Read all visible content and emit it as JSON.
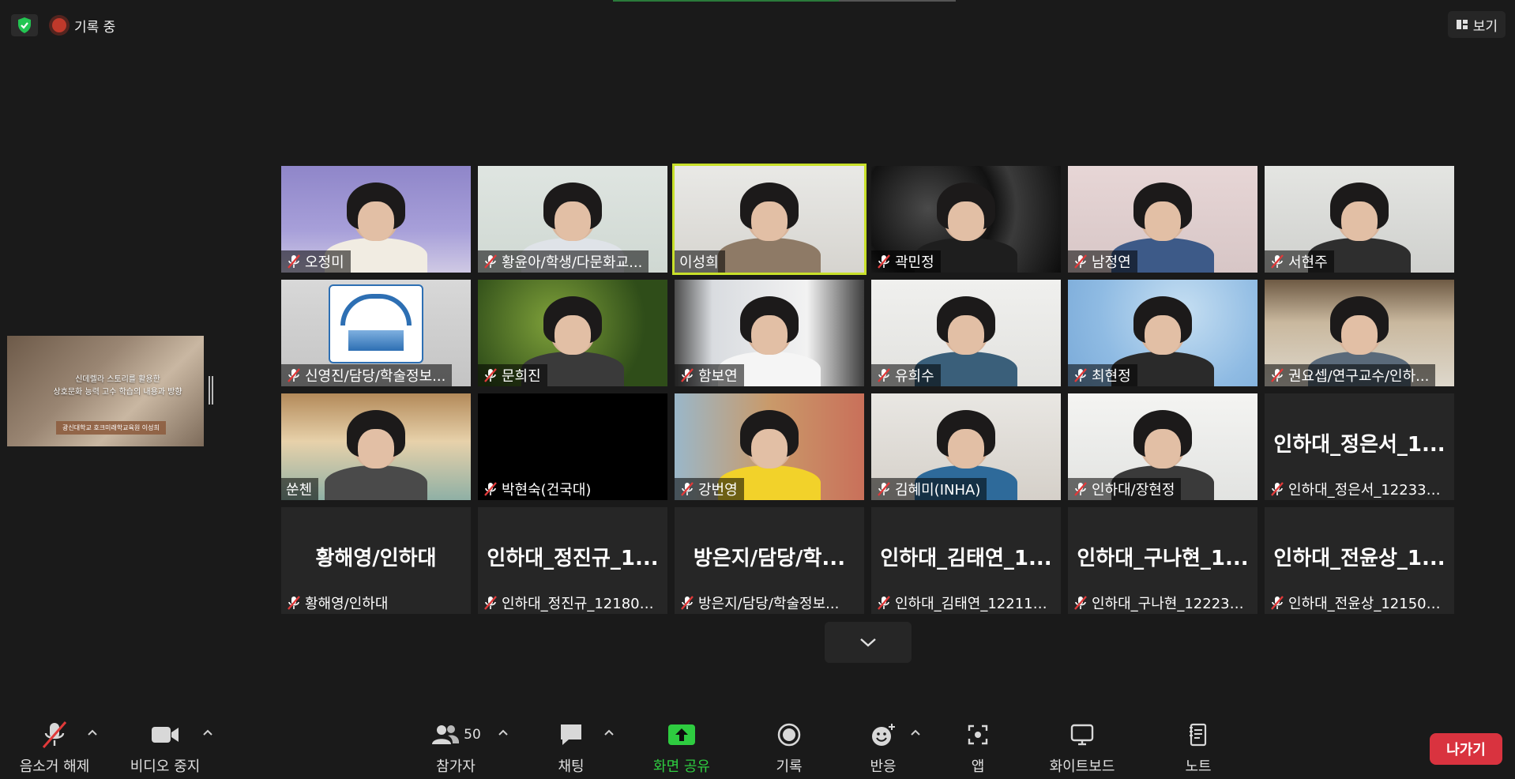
{
  "header": {
    "recording_label": "기록 중",
    "view_label": "보기"
  },
  "shared_screen": {
    "title_line1": "신데렐라 스토리를 활용한",
    "title_line2": "상호문화 능력 고수 학습의 내용과 방향",
    "footer": "광신대학교 호크미래학교육원 이성희"
  },
  "participants": [
    {
      "name": "오정미",
      "muted": true,
      "talking": false,
      "video": true
    },
    {
      "name": "황윤아/학생/다문화교...",
      "muted": true,
      "talking": false,
      "video": true
    },
    {
      "name": "이성희",
      "muted": false,
      "talking": true,
      "video": true
    },
    {
      "name": "곽민정",
      "muted": true,
      "talking": false,
      "video": true
    },
    {
      "name": "남정연",
      "muted": true,
      "talking": false,
      "video": true
    },
    {
      "name": "서현주",
      "muted": true,
      "talking": false,
      "video": true
    },
    {
      "name": "신영진/담당/학술정보...",
      "muted": true,
      "talking": false,
      "video": true
    },
    {
      "name": "문희진",
      "muted": true,
      "talking": false,
      "video": true
    },
    {
      "name": "함보연",
      "muted": true,
      "talking": false,
      "video": true
    },
    {
      "name": "유희수",
      "muted": true,
      "talking": false,
      "video": true
    },
    {
      "name": "최현정",
      "muted": true,
      "talking": false,
      "video": true
    },
    {
      "name": "권요셉/연구교수/인하...",
      "muted": true,
      "talking": false,
      "video": true
    },
    {
      "name": "쑨첸",
      "muted": false,
      "talking": false,
      "video": true
    },
    {
      "name": "박현숙(건국대)",
      "muted": true,
      "talking": false,
      "video": true
    },
    {
      "name": "강번영",
      "muted": true,
      "talking": false,
      "video": true
    },
    {
      "name": "김혜미(INHA)",
      "muted": true,
      "talking": false,
      "video": true
    },
    {
      "name": "인하대/장현정",
      "muted": true,
      "talking": false,
      "video": true
    },
    {
      "name": "인하대_정은서_122331...",
      "display": "인하대_정은서_1...",
      "muted": true,
      "talking": false,
      "video": false
    },
    {
      "name": "황해영/인하대",
      "display": "황해영/인하대",
      "muted": true,
      "talking": false,
      "video": false
    },
    {
      "name": "인하대_정진규_121807...",
      "display": "인하대_정진규_1...",
      "muted": true,
      "talking": false,
      "video": false
    },
    {
      "name": "방은지/담당/학술정보...",
      "display": "방은지/담당/학...",
      "muted": true,
      "talking": false,
      "video": false
    },
    {
      "name": "인하대_김태연_122114...",
      "display": "인하대_김태연_1...",
      "muted": true,
      "talking": false,
      "video": false
    },
    {
      "name": "인하대_구나현_122230...",
      "display": "인하대_구나현_1...",
      "muted": true,
      "talking": false,
      "video": false
    },
    {
      "name": "인하대_전윤상_121504...",
      "display": "인하대_전윤상_1...",
      "muted": true,
      "talking": false,
      "video": false
    }
  ],
  "toolbar": {
    "unmute": "음소거 해제",
    "stop_video": "비디오 중지",
    "participants": "참가자",
    "participant_count": "50",
    "chat": "채팅",
    "share_screen": "화면 공유",
    "record": "기록",
    "reactions": "반응",
    "apps": "앱",
    "whiteboard": "화이트보드",
    "notes": "노트",
    "leave": "나가기"
  },
  "colors": {
    "background": "#1a1a1a",
    "talking_outline": "#c8e02a",
    "share_green": "#2ecc40",
    "leave_red": "#d9333f",
    "mute_red": "#e03a3a"
  }
}
